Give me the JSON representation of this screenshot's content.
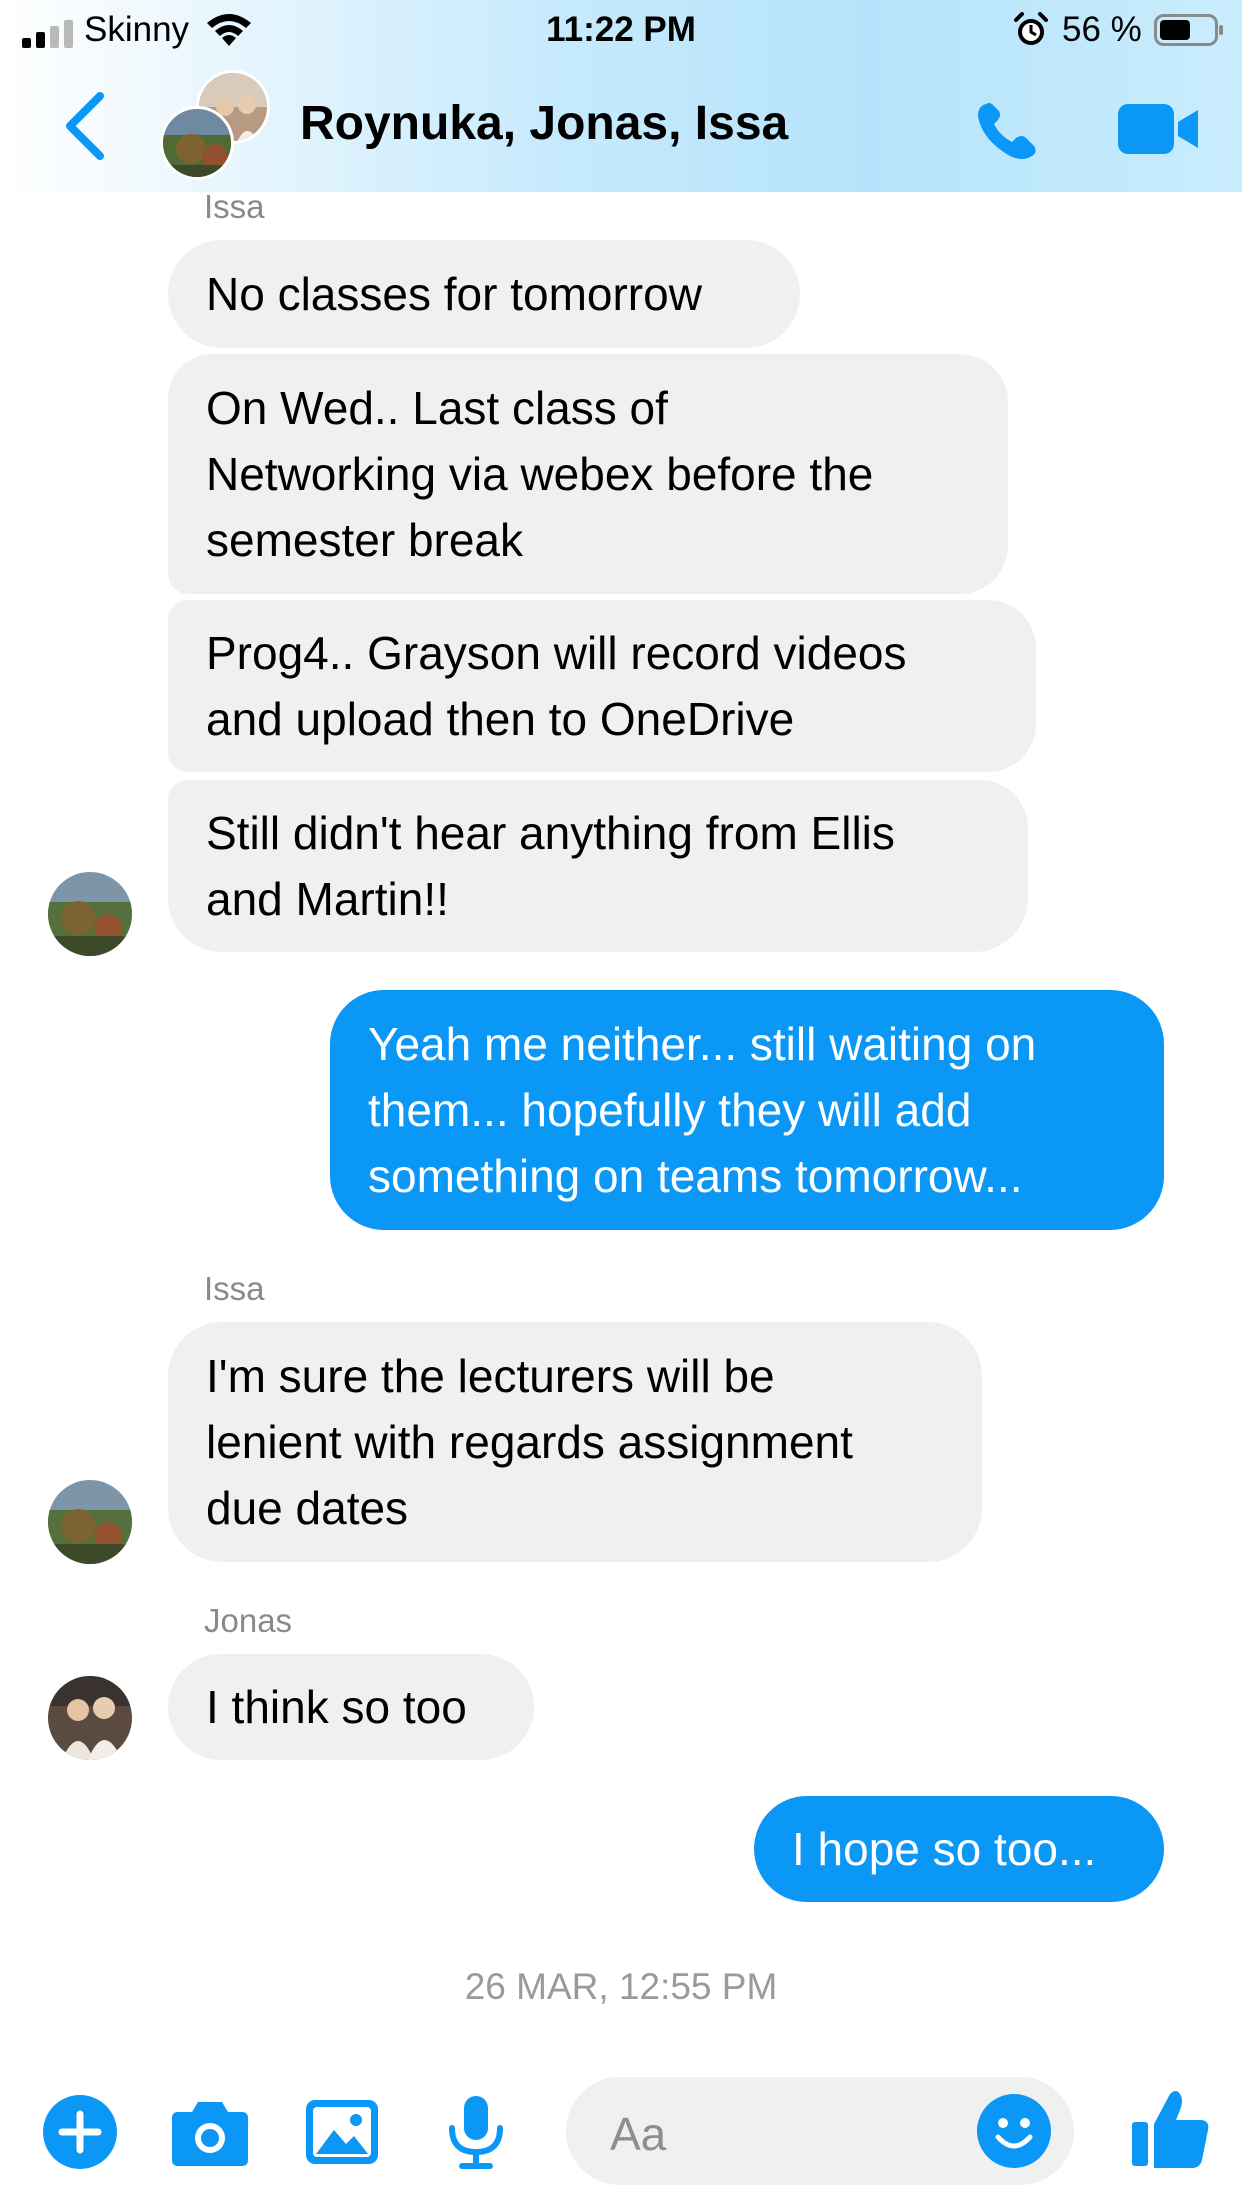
{
  "status_bar": {
    "carrier": "Skinny",
    "time": "11:22 PM",
    "battery": "56 %",
    "battery_level": 0.56,
    "signal_bars": 2
  },
  "header": {
    "title": "Roynuka, Jonas, Issa",
    "back_icon": "chevron-left-icon",
    "call_icon": "phone-icon",
    "video_icon": "video-camera-icon"
  },
  "colors": {
    "accent": "#0a97f6",
    "incoming_bubble": "#f0f0f0",
    "header_tint": "#b6e3fb"
  },
  "messages": [
    {
      "sender": "Issa",
      "text": "No classes for tomorrow"
    },
    {
      "text": "On Wed..  Last class of",
      "text2": "Networking via webex before the",
      "text3": "semester break"
    },
    {
      "text": "Prog4..  Grayson will record videos",
      "text2": "and upload then to OneDrive"
    },
    {
      "text": "Still didn't hear anything from Ellis",
      "text2": "and Martin!!"
    },
    {
      "text": "Yeah me neither... still waiting on",
      "text2": "them... hopefully they will add",
      "text3": "something on teams tomorrow..."
    },
    {
      "sender": "Issa",
      "text": "I'm sure the lecturers will be",
      "text2": "lenient with regards assignment",
      "text3": "due dates"
    },
    {
      "sender": "Jonas",
      "text": "I think so too"
    },
    {
      "text": "I hope so too..."
    }
  ],
  "timestamp": "26 MAR, 12:55 PM",
  "composer": {
    "placeholder": "Aa",
    "icons": [
      "plus-icon",
      "camera-icon",
      "photo-icon",
      "microphone-icon",
      "emoji-icon",
      "thumbs-up-icon"
    ]
  }
}
